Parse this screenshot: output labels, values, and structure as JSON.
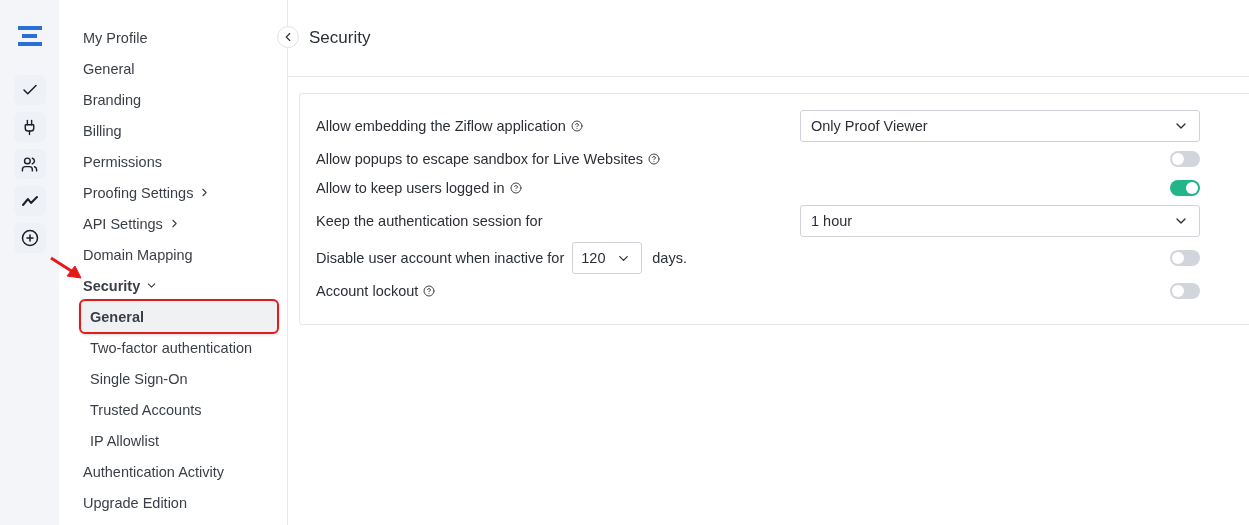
{
  "rail": {
    "items": [
      {
        "kind": "check",
        "selected": false
      },
      {
        "kind": "plug",
        "selected": false
      },
      {
        "kind": "users",
        "selected": false
      },
      {
        "kind": "trend",
        "selected": false
      },
      {
        "kind": "add",
        "selected": false
      }
    ]
  },
  "sidebar": {
    "items": [
      {
        "label": "My Profile",
        "kind": "link"
      },
      {
        "label": "General",
        "kind": "link"
      },
      {
        "label": "Branding",
        "kind": "link"
      },
      {
        "label": "Billing",
        "kind": "link"
      },
      {
        "label": "Permissions",
        "kind": "link"
      },
      {
        "label": "Proofing Settings",
        "kind": "group",
        "expanded": false
      },
      {
        "label": "API Settings",
        "kind": "group",
        "expanded": false
      },
      {
        "label": "Domain Mapping",
        "kind": "link"
      },
      {
        "label": "Security",
        "kind": "group",
        "expanded": true,
        "children": [
          {
            "label": "General",
            "selected": true
          },
          {
            "label": "Two-factor authentication",
            "selected": false
          },
          {
            "label": "Single Sign-On",
            "selected": false
          },
          {
            "label": "Trusted Accounts",
            "selected": false
          },
          {
            "label": "IP Allowlist",
            "selected": false
          }
        ]
      },
      {
        "label": "Authentication Activity",
        "kind": "link"
      },
      {
        "label": "Upgrade Edition",
        "kind": "link"
      }
    ]
  },
  "page": {
    "title": "Security"
  },
  "settings": [
    {
      "kind": "select",
      "label": "Allow embedding the Ziflow application",
      "help": true,
      "value": "Only Proof Viewer"
    },
    {
      "kind": "toggle",
      "label": "Allow popups to escape sandbox for Live Websites",
      "help": true,
      "on": false
    },
    {
      "kind": "toggle",
      "label": "Allow to keep users logged in",
      "help": true,
      "on": true
    },
    {
      "kind": "select",
      "label": "Keep the authentication session for",
      "help": false,
      "value": "1 hour"
    },
    {
      "kind": "inline",
      "label": "Disable user account when inactive for",
      "value": "120",
      "suffix": "days.",
      "on": false
    },
    {
      "kind": "toggle",
      "label": "Account lockout",
      "help": true,
      "on": false
    }
  ]
}
